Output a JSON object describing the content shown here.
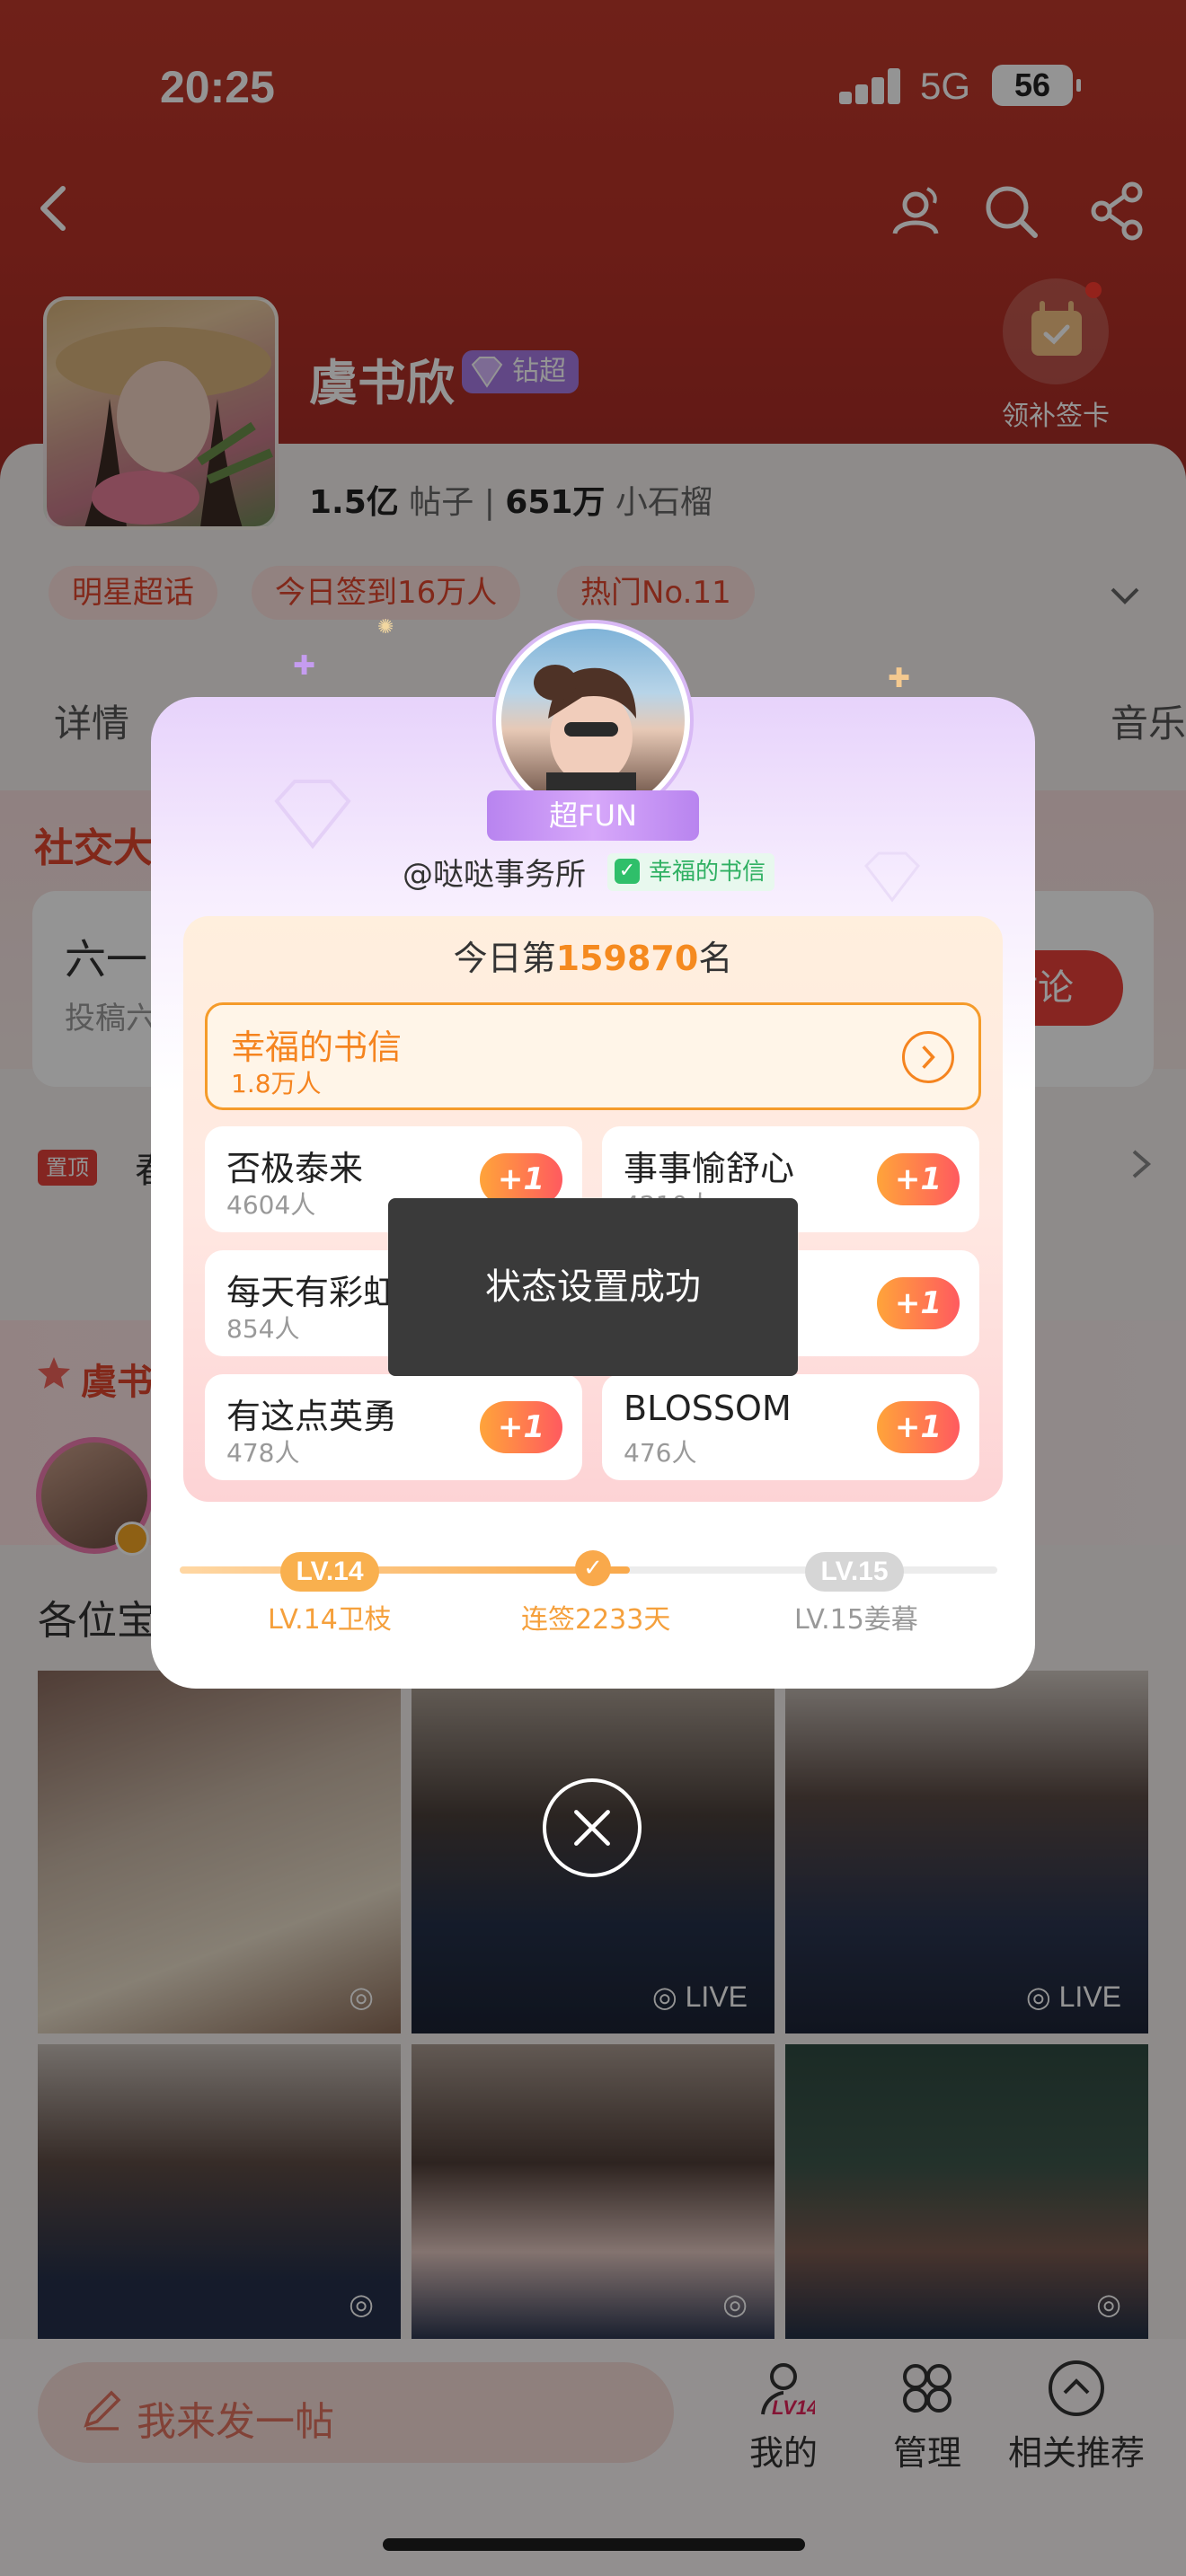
{
  "status_bar": {
    "time": "20:25",
    "network": "5G",
    "battery": "56"
  },
  "sign_in_card": {
    "label": "领补签卡"
  },
  "profile": {
    "name": "虞书欣",
    "badge": "钻超",
    "posts_count": "1.5亿",
    "posts_label": "帖子",
    "fans_count": "651万",
    "fans_label": "小石榴"
  },
  "tags": [
    "明星超话",
    "今日签到16万人",
    "热门No.11"
  ],
  "tabs": {
    "left": "详情",
    "right": "音乐"
  },
  "activity": {
    "title": "社交大",
    "card_line1": "六一",
    "card_line2": "投稿六",
    "discuss_button": "讨论"
  },
  "pinned": {
    "tag": "置顶",
    "text": "春"
  },
  "fan_section": {
    "title": "虞书",
    "post_title": "各位宝"
  },
  "photos": [
    {
      "live": ""
    },
    {
      "live": "LIVE"
    },
    {
      "live": "LIVE"
    },
    {
      "live": ""
    },
    {
      "live": ""
    },
    {
      "live": ""
    }
  ],
  "bottom_bar": {
    "post_placeholder": "我来发一帖",
    "level_icon": "LV14",
    "tabs": [
      "我的",
      "管理",
      "相关推荐"
    ]
  },
  "modal": {
    "ribbon": "超FUN",
    "handle": "@哒哒事务所",
    "status": "幸福的书信",
    "rank_prefix": "今日第",
    "rank_number": "159870",
    "rank_suffix": "名",
    "selected": {
      "name": "幸福的书信",
      "count": "1.8万人"
    },
    "options": [
      {
        "name": "否极泰来",
        "count": "4604人",
        "action": "+1"
      },
      {
        "name": "事事愉舒心",
        "count": "4210人",
        "action": "+1"
      },
      {
        "name": "每天有彩虹",
        "count": "854人",
        "action": "+1"
      },
      {
        "name": "",
        "count": "",
        "action": "+1"
      },
      {
        "name": "有这点英勇",
        "count": "478人",
        "action": "+1"
      },
      {
        "name": "BLOSSOM",
        "count": "476人",
        "action": "+1"
      }
    ],
    "progress": {
      "current_level": "LV.14",
      "current_label": "LV.14卫枝",
      "streak": "连签2233天",
      "next_level": "LV.15",
      "next_label": "LV.15姜暮",
      "fraction": 0.55
    }
  },
  "toast": "状态设置成功"
}
